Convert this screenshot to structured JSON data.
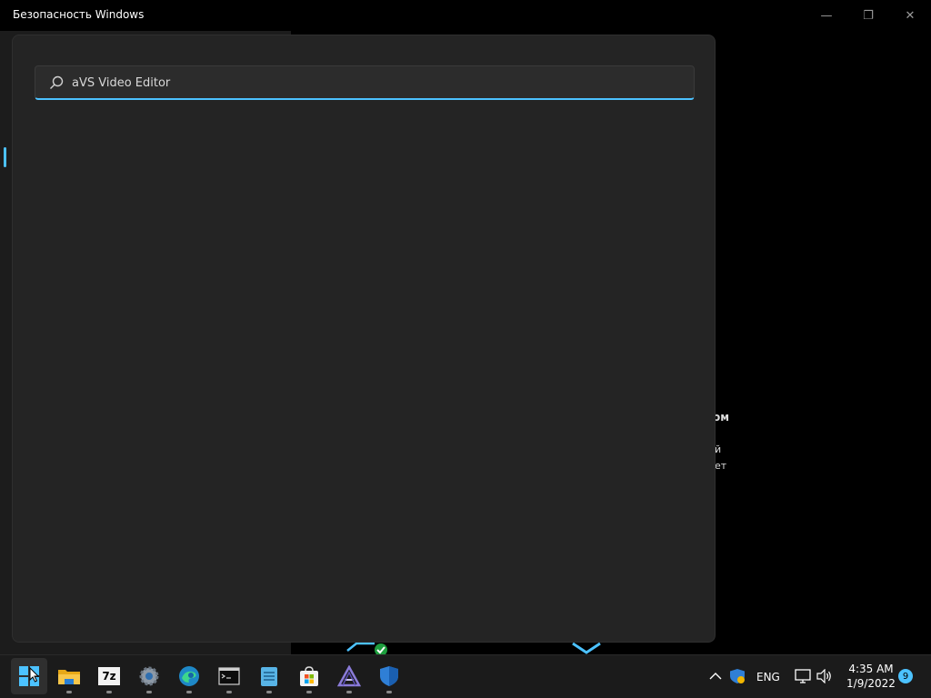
{
  "window": {
    "title": "Безопасность Windows",
    "controls": [
      "minimize-icon",
      "maximize-icon",
      "close-icon"
    ]
  },
  "background": {
    "fragments": [
      "ом",
      "й",
      "ет"
    ]
  },
  "search": {
    "value": "aVS Video Editor",
    "icon": "search-icon"
  },
  "taskbar": {
    "apps": [
      {
        "name": "start-icon",
        "active": true
      },
      {
        "name": "file-explorer-icon"
      },
      {
        "name": "7zip-icon",
        "label": "7z"
      },
      {
        "name": "settings-icon"
      },
      {
        "name": "edge-icon"
      },
      {
        "name": "terminal-icon"
      },
      {
        "name": "notepad-icon"
      },
      {
        "name": "store-icon"
      },
      {
        "name": "avs-editor-icon"
      },
      {
        "name": "windows-security-icon"
      }
    ],
    "tray": {
      "language": "ENG",
      "time": "4:35 AM",
      "date": "1/9/2022",
      "notification_count": "9"
    }
  },
  "colors": {
    "accent": "#4cc2ff",
    "panel": "#242424"
  }
}
